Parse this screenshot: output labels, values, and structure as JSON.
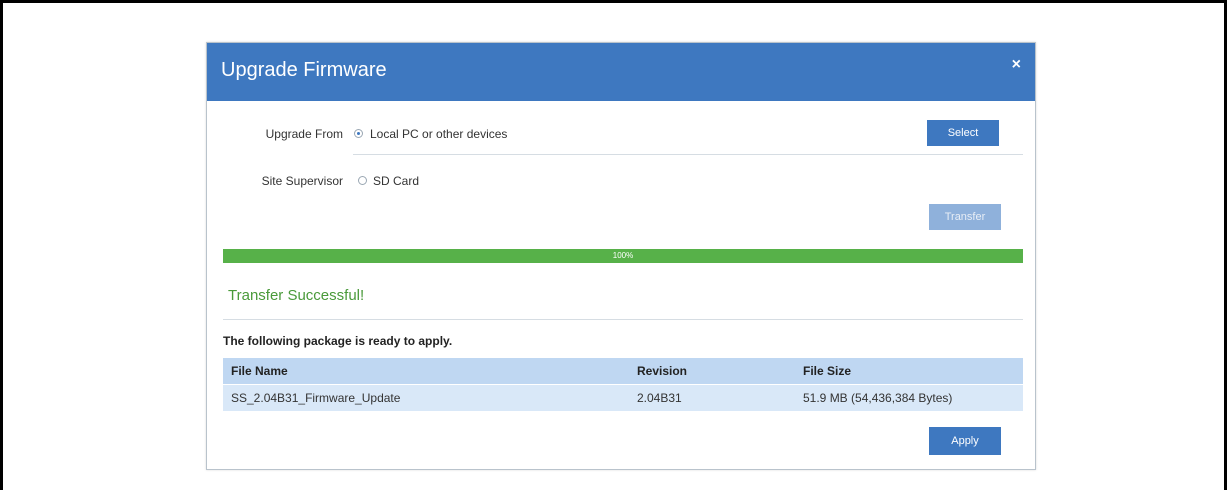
{
  "dialog": {
    "title": "Upgrade Firmware",
    "close_glyph": "×"
  },
  "upgrade": {
    "from_label": "Upgrade From",
    "option_local": "Local PC or other devices",
    "site_label": "Site Supervisor",
    "option_sd": "SD Card",
    "selected": "Local PC or other devices"
  },
  "buttons": {
    "select": "Select",
    "transfer": "Transfer",
    "apply": "Apply"
  },
  "progress": {
    "value": 100,
    "text": "100%"
  },
  "status": {
    "success": "Transfer Successful!",
    "ready": "The following package is ready to apply."
  },
  "table": {
    "headers": [
      "File Name",
      "Revision",
      "File Size"
    ],
    "rows": [
      [
        "SS_2.04B31_Firmware_Update",
        "2.04B31",
        "51.9 MB (54,436,384 Bytes)"
      ]
    ]
  },
  "colors": {
    "header_blue": "#3e78c0",
    "progress_green": "#57b149",
    "success_green": "#4a9a3a",
    "table_header": "#bfd7f2",
    "table_row": "#d9e8f8"
  }
}
